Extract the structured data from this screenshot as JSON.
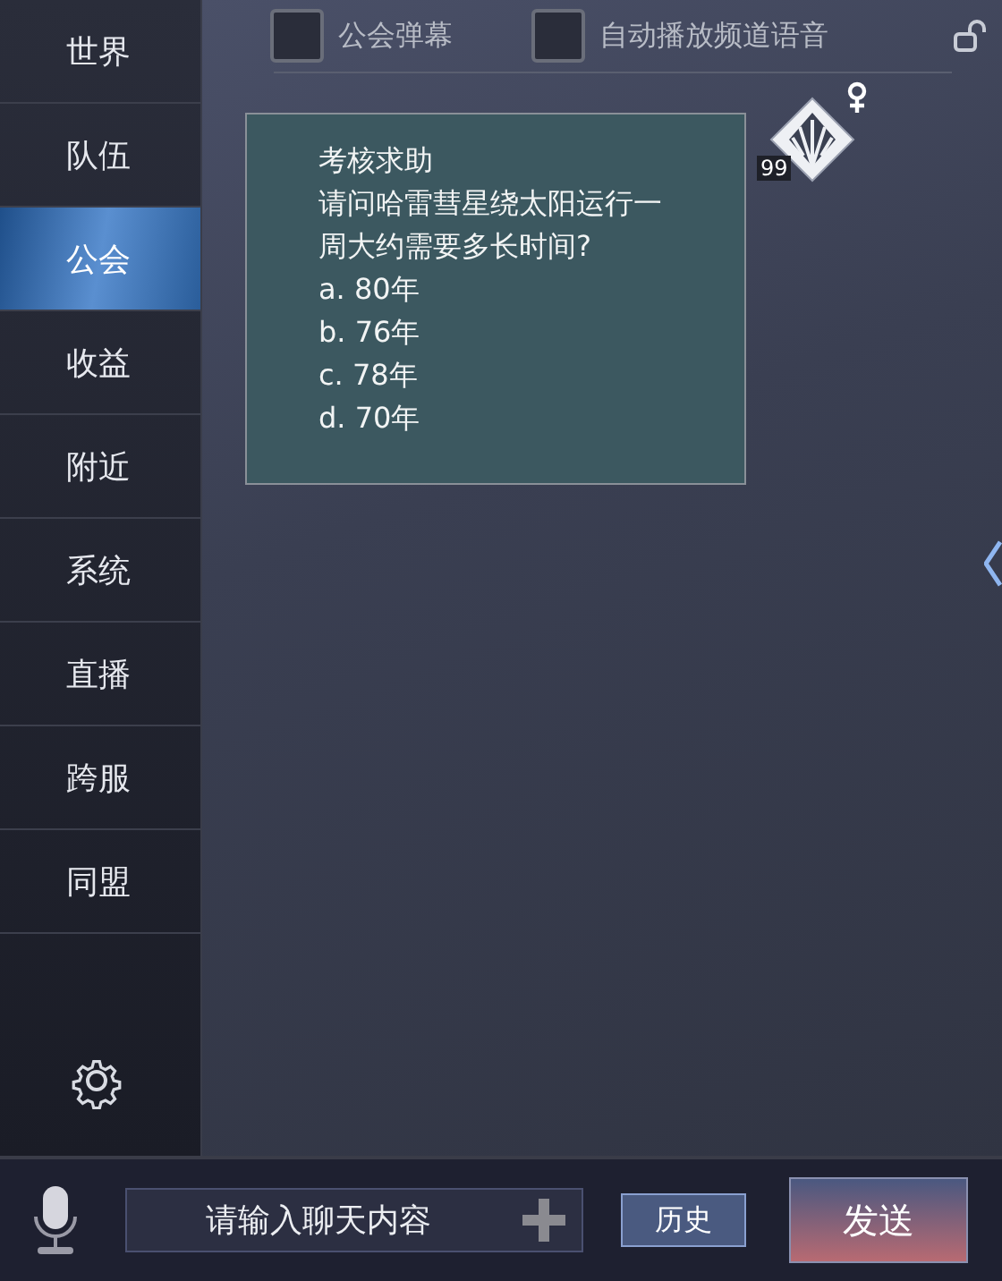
{
  "sidebar": {
    "items": [
      {
        "label": "世界",
        "selected": false
      },
      {
        "label": "队伍",
        "selected": false
      },
      {
        "label": "公会",
        "selected": true
      },
      {
        "label": "收益",
        "selected": false
      },
      {
        "label": "附近",
        "selected": false
      },
      {
        "label": "系统",
        "selected": false
      },
      {
        "label": "直播",
        "selected": false
      },
      {
        "label": "跨服",
        "selected": false
      },
      {
        "label": "同盟",
        "selected": false
      }
    ]
  },
  "options": [
    {
      "label": "公会弹幕",
      "checked": false
    },
    {
      "label": "自动播放频道语音",
      "checked": false
    }
  ],
  "message": {
    "lines": [
      "考核求助",
      "请问哈雷彗星绕太阳运行一",
      "周大约需要多长时间?",
      "a. 80年",
      "b. 76年",
      "c. 78年",
      "d. 70年"
    ],
    "level_badge": "99"
  },
  "input": {
    "placeholder": "请输入聊天内容"
  },
  "history_button": "历史",
  "send_button": "发送"
}
